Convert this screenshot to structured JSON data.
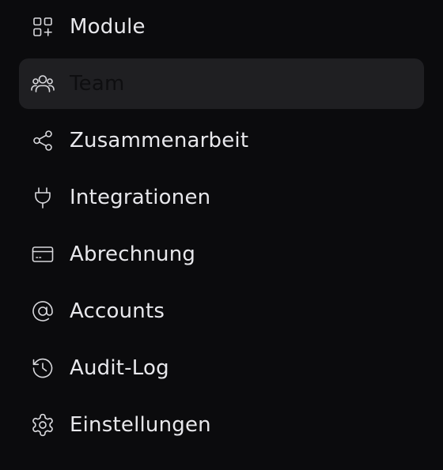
{
  "menu": {
    "items": [
      {
        "label": "Module",
        "icon": "modules-grid-plus-icon"
      },
      {
        "label": "Team",
        "icon": "users-icon",
        "active": true
      },
      {
        "label": "Zusammenarbeit",
        "icon": "share-nodes-icon"
      },
      {
        "label": "Integrationen",
        "icon": "plug-icon"
      },
      {
        "label": "Abrechnung",
        "icon": "credit-card-icon"
      },
      {
        "label": "Accounts",
        "icon": "at-sign-icon"
      },
      {
        "label": "Audit-Log",
        "icon": "history-icon"
      },
      {
        "label": "Einstellungen",
        "icon": "gear-icon"
      }
    ]
  },
  "colors": {
    "background": "#0b0b0d",
    "active_background": "#1f1f22",
    "text": "#e8e8ec",
    "active_text": "#0e0e10",
    "icon": "#d8d8dc"
  }
}
